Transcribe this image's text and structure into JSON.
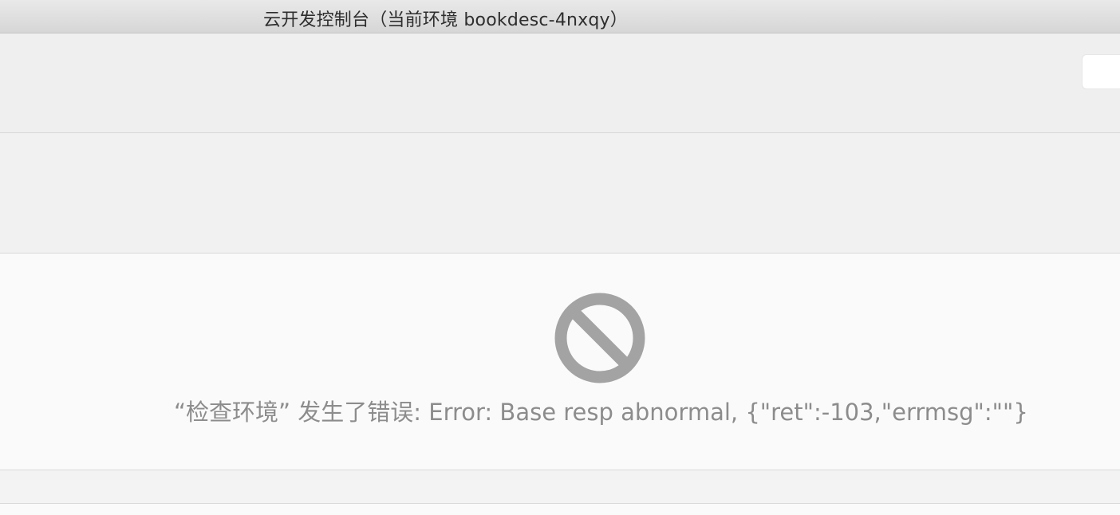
{
  "window": {
    "title": "云开发控制台（当前环境 bookdesc-4nxqy）"
  },
  "error": {
    "icon": "prohibited-icon",
    "message": "“检查环境” 发生了错误: Error: Base resp abnormal, {\"ret\":-103,\"errmsg\":\"\"}"
  },
  "colors": {
    "icon": "#a3a3a3",
    "message": "#8c8c8c"
  }
}
